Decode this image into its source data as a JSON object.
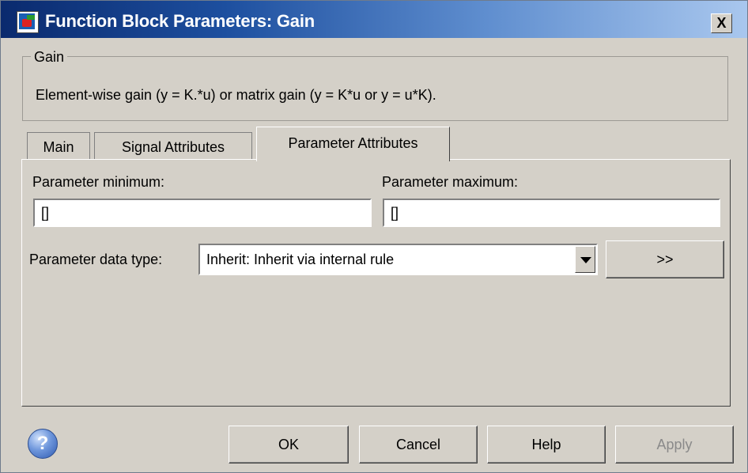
{
  "window": {
    "title": "Function Block Parameters: Gain",
    "close_label": "X"
  },
  "group": {
    "label": "Gain",
    "description": "Element-wise gain (y = K.*u) or matrix gain (y = K*u or y = u*K)."
  },
  "tabs": [
    {
      "label": "Main",
      "active": false
    },
    {
      "label": "Signal Attributes",
      "active": false
    },
    {
      "label": "Parameter Attributes",
      "active": true
    }
  ],
  "parameters": {
    "min_label": "Parameter minimum:",
    "min_value": "[]",
    "max_label": "Parameter maximum:",
    "max_value": "[]",
    "data_type_label": "Parameter data type:",
    "data_type_value": "Inherit: Inherit via internal rule",
    "data_type_assistant_label": ">>"
  },
  "buttons": {
    "help_icon": "?",
    "ok": "OK",
    "cancel": "Cancel",
    "help": "Help",
    "apply": "Apply"
  },
  "colors": {
    "dialog_bg": "#d4d0c8",
    "title_gradient_start": "#0a2a6e",
    "title_gradient_end": "#a9c7ee",
    "disabled_text": "#8a8a8a"
  }
}
